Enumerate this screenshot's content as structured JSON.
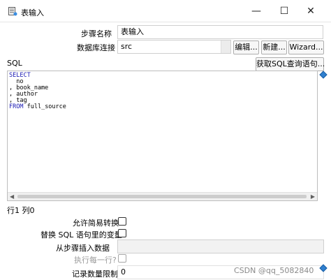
{
  "window": {
    "title": "表输入",
    "minimize_glyph": "—",
    "maximize_glyph": "☐",
    "close_glyph": "✕"
  },
  "form": {
    "step_name_label": "步骤名称",
    "step_name_value": "表输入",
    "db_connection_label": "数据库连接",
    "db_connection_value": "src",
    "edit_button": "编辑...",
    "new_button": "新建...",
    "wizard_button": "Wizard..."
  },
  "sql": {
    "label": "SQL",
    "get_sql_button": "获取SQL查询语句...",
    "lines": [
      {
        "kw": "SELECT",
        "text": ""
      },
      {
        "kw": "",
        "text": "  no"
      },
      {
        "kw": "",
        "text": ", book_name"
      },
      {
        "kw": "",
        "text": ", author"
      },
      {
        "kw": "",
        "text": ", tag"
      },
      {
        "kw": "FROM",
        "text": " full_source"
      }
    ],
    "scroll_left": "◀",
    "scroll_right": "▶"
  },
  "status": {
    "cursor_position": "行1 列0"
  },
  "options": {
    "lazy_conversion_label": "允许简易转换",
    "lazy_conversion_checked": false,
    "replace_vars_label": "替换 SQL 语句里的变量",
    "replace_vars_checked": false,
    "insert_from_step_label": "从步骤插入数据",
    "insert_from_step_value": "",
    "execute_each_row_label": "执行每一行?",
    "execute_each_row_checked": false,
    "limit_label": "记录数量限制",
    "limit_value": "0"
  },
  "watermark": "CSDN @qq_5082840",
  "colors": {
    "keyword": "#1a1ab3",
    "accent_icon": "#2f7fcf"
  }
}
